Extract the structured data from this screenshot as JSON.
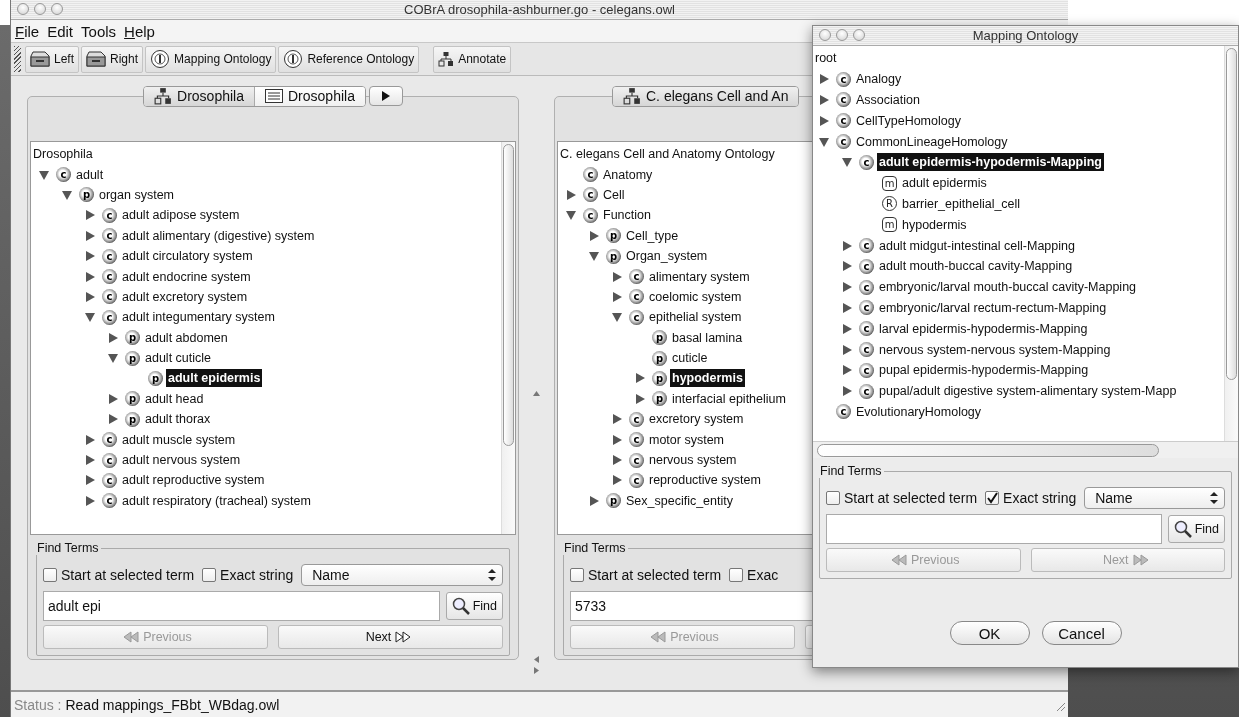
{
  "window": {
    "title": "COBrA  drosophila-ashburner.go - celegans.owl"
  },
  "menu": [
    {
      "label": "File",
      "mnemonic": true
    },
    {
      "label": "Edit",
      "mnemonic": false
    },
    {
      "label": "Tools",
      "mnemonic": false
    },
    {
      "label": "Help",
      "mnemonic": true
    }
  ],
  "toolbar": [
    {
      "buttons": [
        {
          "label": "Left",
          "kind": "drive"
        },
        {
          "label": "Right",
          "kind": "drive"
        },
        {
          "label": "Mapping Ontology",
          "kind": "ontology"
        },
        {
          "label": "Reference Ontology",
          "kind": "ontology"
        }
      ]
    },
    {
      "buttons": [
        {
          "label": "Annotate",
          "kind": "hierarchy"
        }
      ]
    }
  ],
  "left_panel": {
    "tabs": [
      {
        "label": "Drosophila",
        "kind": "hierarchy",
        "selected": false
      },
      {
        "label": "Drosophila",
        "kind": "text",
        "selected": true
      }
    ],
    "more_button": true,
    "tree": {
      "root": "Drosophila",
      "nodes": [
        {
          "label": "adult",
          "badge": "c",
          "kind": "class",
          "expandable": true,
          "expanded": true,
          "selected": false,
          "children": [
            {
              "label": "organ system",
              "badge": "p",
              "kind": "part",
              "expandable": true,
              "expanded": true,
              "selected": false,
              "children": [
                {
                  "label": "adult adipose system",
                  "badge": "c",
                  "kind": "class",
                  "expandable": true,
                  "expanded": false,
                  "selected": false
                },
                {
                  "label": "adult alimentary (digestive) system",
                  "badge": "c",
                  "kind": "class",
                  "expandable": true,
                  "expanded": false,
                  "selected": false
                },
                {
                  "label": "adult circulatory system",
                  "badge": "c",
                  "kind": "class",
                  "expandable": true,
                  "expanded": false,
                  "selected": false
                },
                {
                  "label": "adult endocrine system",
                  "badge": "c",
                  "kind": "class",
                  "expandable": true,
                  "expanded": false,
                  "selected": false
                },
                {
                  "label": "adult excretory system",
                  "badge": "c",
                  "kind": "class",
                  "expandable": true,
                  "expanded": false,
                  "selected": false
                },
                {
                  "label": "adult integumentary system",
                  "badge": "c",
                  "kind": "class",
                  "expandable": true,
                  "expanded": true,
                  "selected": false,
                  "children": [
                    {
                      "label": "adult abdomen",
                      "badge": "p",
                      "kind": "part",
                      "expandable": true,
                      "expanded": false,
                      "selected": false
                    },
                    {
                      "label": "adult cuticle",
                      "badge": "p",
                      "kind": "part",
                      "expandable": true,
                      "expanded": true,
                      "selected": false,
                      "children": [
                        {
                          "label": "adult epidermis",
                          "badge": "p",
                          "kind": "part",
                          "expandable": false,
                          "selected": true
                        }
                      ]
                    },
                    {
                      "label": "adult head",
                      "badge": "p",
                      "kind": "part",
                      "expandable": true,
                      "expanded": false,
                      "selected": false
                    },
                    {
                      "label": "adult thorax",
                      "badge": "p",
                      "kind": "part",
                      "expandable": true,
                      "expanded": false,
                      "selected": false
                    }
                  ]
                },
                {
                  "label": "adult muscle system",
                  "badge": "c",
                  "kind": "class",
                  "expandable": true,
                  "expanded": false,
                  "selected": false
                },
                {
                  "label": "adult nervous system",
                  "badge": "c",
                  "kind": "class",
                  "expandable": true,
                  "expanded": false,
                  "selected": false
                },
                {
                  "label": "adult reproductive system",
                  "badge": "c",
                  "kind": "class",
                  "expandable": true,
                  "expanded": false,
                  "selected": false
                },
                {
                  "label": "adult respiratory (tracheal) system",
                  "badge": "c",
                  "kind": "class",
                  "expandable": true,
                  "expanded": false,
                  "selected": false
                }
              ]
            }
          ]
        }
      ]
    },
    "find": {
      "title": "Find Terms",
      "options": [
        {
          "label": "Start at selected term",
          "checked": false
        },
        {
          "label": "Exact string",
          "checked": false
        }
      ],
      "select": "Name",
      "value": "adult epi",
      "find_label": "Find",
      "nav": [
        {
          "label": "Previous",
          "kind": "previous",
          "disabled": true
        },
        {
          "label": "Next",
          "kind": "next",
          "disabled": false
        }
      ]
    }
  },
  "right_panel": {
    "tabs": [
      {
        "label": "C. elegans Cell and An",
        "kind": "hierarchy",
        "selected": false
      }
    ],
    "more_button": false,
    "tree": {
      "root": "C. elegans Cell and Anatomy Ontology",
      "nodes": [
        {
          "label": "Anatomy",
          "badge": "c",
          "kind": "class",
          "expandable": false,
          "selected": false
        },
        {
          "label": "Cell",
          "badge": "c",
          "kind": "class",
          "expandable": true,
          "expanded": false,
          "selected": false
        },
        {
          "label": "Function",
          "badge": "c",
          "kind": "class",
          "expandable": true,
          "expanded": true,
          "selected": false,
          "children": [
            {
              "label": "Cell_type",
              "badge": "p",
              "kind": "part",
              "expandable": true,
              "expanded": false,
              "selected": false
            },
            {
              "label": "Organ_system",
              "badge": "p",
              "kind": "part",
              "expandable": true,
              "expanded": true,
              "selected": false,
              "children": [
                {
                  "label": "alimentary system",
                  "badge": "c",
                  "kind": "class",
                  "expandable": true,
                  "expanded": false,
                  "selected": false
                },
                {
                  "label": "coelomic system",
                  "badge": "c",
                  "kind": "class",
                  "expandable": true,
                  "expanded": false,
                  "selected": false
                },
                {
                  "label": "epithelial system",
                  "badge": "c",
                  "kind": "class",
                  "expandable": true,
                  "expanded": true,
                  "selected": false,
                  "children": [
                    {
                      "label": "basal lamina",
                      "badge": "p",
                      "kind": "part",
                      "expandable": false,
                      "selected": false
                    },
                    {
                      "label": "cuticle",
                      "badge": "p",
                      "kind": "part",
                      "expandable": false,
                      "selected": false
                    },
                    {
                      "label": "hypodermis",
                      "badge": "p",
                      "kind": "part",
                      "expandable": true,
                      "expanded": false,
                      "selected": true
                    },
                    {
                      "label": "interfacial epithelium",
                      "badge": "p",
                      "kind": "part",
                      "expandable": true,
                      "expanded": false,
                      "selected": false
                    }
                  ]
                },
                {
                  "label": "excretory system",
                  "badge": "c",
                  "kind": "class",
                  "expandable": true,
                  "expanded": false,
                  "selected": false
                },
                {
                  "label": "motor system",
                  "badge": "c",
                  "kind": "class",
                  "expandable": true,
                  "expanded": false,
                  "selected": false
                },
                {
                  "label": "nervous system",
                  "badge": "c",
                  "kind": "class",
                  "expandable": true,
                  "expanded": false,
                  "selected": false
                },
                {
                  "label": "reproductive system",
                  "badge": "c",
                  "kind": "class",
                  "expandable": true,
                  "expanded": false,
                  "selected": false
                }
              ]
            },
            {
              "label": "Sex_specific_entity",
              "badge": "p",
              "kind": "part",
              "expandable": true,
              "expanded": false,
              "selected": false
            }
          ]
        }
      ]
    },
    "find": {
      "title": "Find Terms",
      "options": [
        {
          "label": "Start at selected term",
          "checked": false
        },
        {
          "label": "Exac",
          "checked": false
        }
      ],
      "value": "5733",
      "nav": [
        {
          "label": "Previous",
          "kind": "previous",
          "disabled": true
        },
        {
          "kind": "next"
        }
      ]
    }
  },
  "status_bar": {
    "label": "Status :",
    "text": "Read mappings_FBbt_WBdag.owl"
  },
  "dialog": {
    "title": "Mapping Ontology",
    "tree": {
      "root": "root",
      "nodes": [
        {
          "label": "Analogy",
          "badge": "c",
          "kind": "class",
          "expandable": true,
          "expanded": false,
          "selected": false
        },
        {
          "label": "Association",
          "badge": "c",
          "kind": "class",
          "expandable": true,
          "expanded": false,
          "selected": false
        },
        {
          "label": "CellTypeHomology",
          "badge": "c",
          "kind": "class",
          "expandable": true,
          "expanded": false,
          "selected": false
        },
        {
          "label": "CommonLineageHomology",
          "badge": "c",
          "kind": "class",
          "expandable": true,
          "expanded": true,
          "selected": false,
          "children": [
            {
              "label": "adult epidermis-hypodermis-Mapping",
              "badge": "c",
              "kind": "class",
              "expandable": true,
              "expanded": true,
              "selected": true,
              "children": [
                {
                  "label": "adult epidermis",
                  "badge": "m",
                  "kind": "mapped",
                  "expandable": false,
                  "selected": false
                },
                {
                  "label": "barrier_epithelial_cell",
                  "badge": "R",
                  "kind": "reference",
                  "expandable": false,
                  "selected": false
                },
                {
                  "label": "hypodermis",
                  "badge": "m",
                  "kind": "mapped",
                  "expandable": false,
                  "selected": false
                }
              ]
            },
            {
              "label": "adult midgut-intestinal cell-Mapping",
              "badge": "c",
              "kind": "class",
              "expandable": true,
              "expanded": false,
              "selected": false
            },
            {
              "label": "adult mouth-buccal cavity-Mapping",
              "badge": "c",
              "kind": "class",
              "expandable": true,
              "expanded": false,
              "selected": false
            },
            {
              "label": "embryonic/larval mouth-buccal cavity-Mapping",
              "badge": "c",
              "kind": "class",
              "expandable": true,
              "expanded": false,
              "selected": false
            },
            {
              "label": "embryonic/larval rectum-rectum-Mapping",
              "badge": "c",
              "kind": "class",
              "expandable": true,
              "expanded": false,
              "selected": false
            },
            {
              "label": "larval epidermis-hypodermis-Mapping",
              "badge": "c",
              "kind": "class",
              "expandable": true,
              "expanded": false,
              "selected": false
            },
            {
              "label": "nervous system-nervous system-Mapping",
              "badge": "c",
              "kind": "class",
              "expandable": true,
              "expanded": false,
              "selected": false
            },
            {
              "label": "pupal epidermis-hypodermis-Mapping",
              "badge": "c",
              "kind": "class",
              "expandable": true,
              "expanded": false,
              "selected": false
            },
            {
              "label": "pupal/adult digestive system-alimentary system-Mapp",
              "badge": "c",
              "kind": "class",
              "expandable": true,
              "expanded": false,
              "selected": false
            }
          ]
        },
        {
          "label": "EvolutionaryHomology",
          "badge": "c",
          "kind": "class",
          "expandable": false,
          "selected": false
        }
      ]
    },
    "find": {
      "title": "Find Terms",
      "options": [
        {
          "label": "Start at selected term",
          "checked": false
        },
        {
          "label": "Exact string",
          "checked": true
        }
      ],
      "select": "Name",
      "find_label": "Find",
      "nav": [
        {
          "label": "Previous",
          "kind": "previous",
          "disabled": true
        },
        {
          "label": "Next",
          "kind": "next",
          "disabled": true
        }
      ]
    },
    "buttons": [
      {
        "label": "OK"
      },
      {
        "label": "Cancel"
      }
    ]
  }
}
